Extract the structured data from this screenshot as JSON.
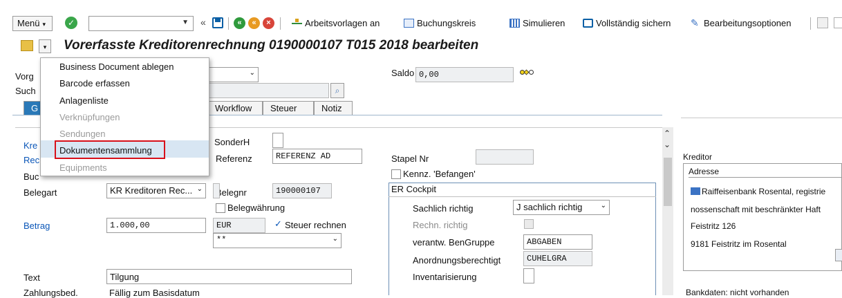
{
  "toolbar": {
    "menu_label": "Menü",
    "back": "«",
    "items": {
      "arbeitsvorlagen": "Arbeitsvorlagen an",
      "buchungskreis": "Buchungskreis",
      "simulieren": "Simulieren",
      "vollstaendig": "Vollständig sichern",
      "bearbeitungsoptionen": "Bearbeitungsoptionen"
    }
  },
  "title": "Vorerfasste Kreditorenrechnung 0190000107 T015 2018 bearbeiten",
  "header": {
    "vorg_label": "Vorg",
    "such_label": "Such",
    "saldo_label": "Saldo",
    "saldo_value": "0,00"
  },
  "tabs": [
    "G",
    "Workflow",
    "Steuer",
    "Notiz"
  ],
  "menu": {
    "items": [
      {
        "label": "Business Document ablegen",
        "enabled": true
      },
      {
        "label": "Barcode erfassen",
        "enabled": true
      },
      {
        "label": "Anlagenliste",
        "enabled": true
      },
      {
        "label": "Verknüpfungen",
        "enabled": false
      },
      {
        "label": "Sendungen",
        "enabled": false
      },
      {
        "label": "Dokumentensammlung",
        "enabled": true
      },
      {
        "label": "Equipments",
        "enabled": false
      }
    ]
  },
  "form": {
    "kre_label": "Kre",
    "rec_label": "Rec",
    "buc_label": "Buc",
    "sonderh_label": "SonderH",
    "referenz_label": "Referenz",
    "referenz_value": "REFERENZ AD",
    "stapel_label": "Stapel Nr",
    "kennz_label": "Kennz. 'Befangen'",
    "belegart_label": "Belegart",
    "belegart_value": "KR Kreditoren Rec...",
    "belegnr_label": "Belegnr",
    "belegnr_value": "190000107",
    "belegwaehrung_label": "Belegwährung",
    "betrag_label": "Betrag",
    "betrag_value": "1.000,00",
    "currency_value": "EUR",
    "steuer_label": "Steuer rechnen",
    "tax_value": "**",
    "text_label": "Text",
    "text_value": "Tilgung",
    "zahlung_label": "Zahlungsbed.",
    "zahlung_value": "Fällig zum Basisdatum"
  },
  "er_cockpit": {
    "title": "ER Cockpit",
    "sachlich_label": "Sachlich richtig",
    "sachlich_value": "J sachlich richtig",
    "rechn_label": "Rechn. richtig",
    "verantw_label": "verantw. BenGruppe",
    "verantw_value": "ABGABEN",
    "anordnung_label": "Anordnungsberechtigt",
    "anordnung_value": "CUHELGRA",
    "inventar_label": "Inventarisierung"
  },
  "kreditor": {
    "title": "Kreditor",
    "adresse_label": "Adresse",
    "lines": [
      "Raiffeisenbank Rosental, registrie",
      "nossenschaft mit beschränkter Haft",
      "Feistritz 126",
      "9181 Feistritz im Rosental"
    ],
    "bank": "Bankdaten: nicht vorhanden"
  },
  "colors": {
    "accent_blue": "#0a56b8",
    "highlight": "#d8e6f3",
    "red_border": "#d8101a"
  }
}
